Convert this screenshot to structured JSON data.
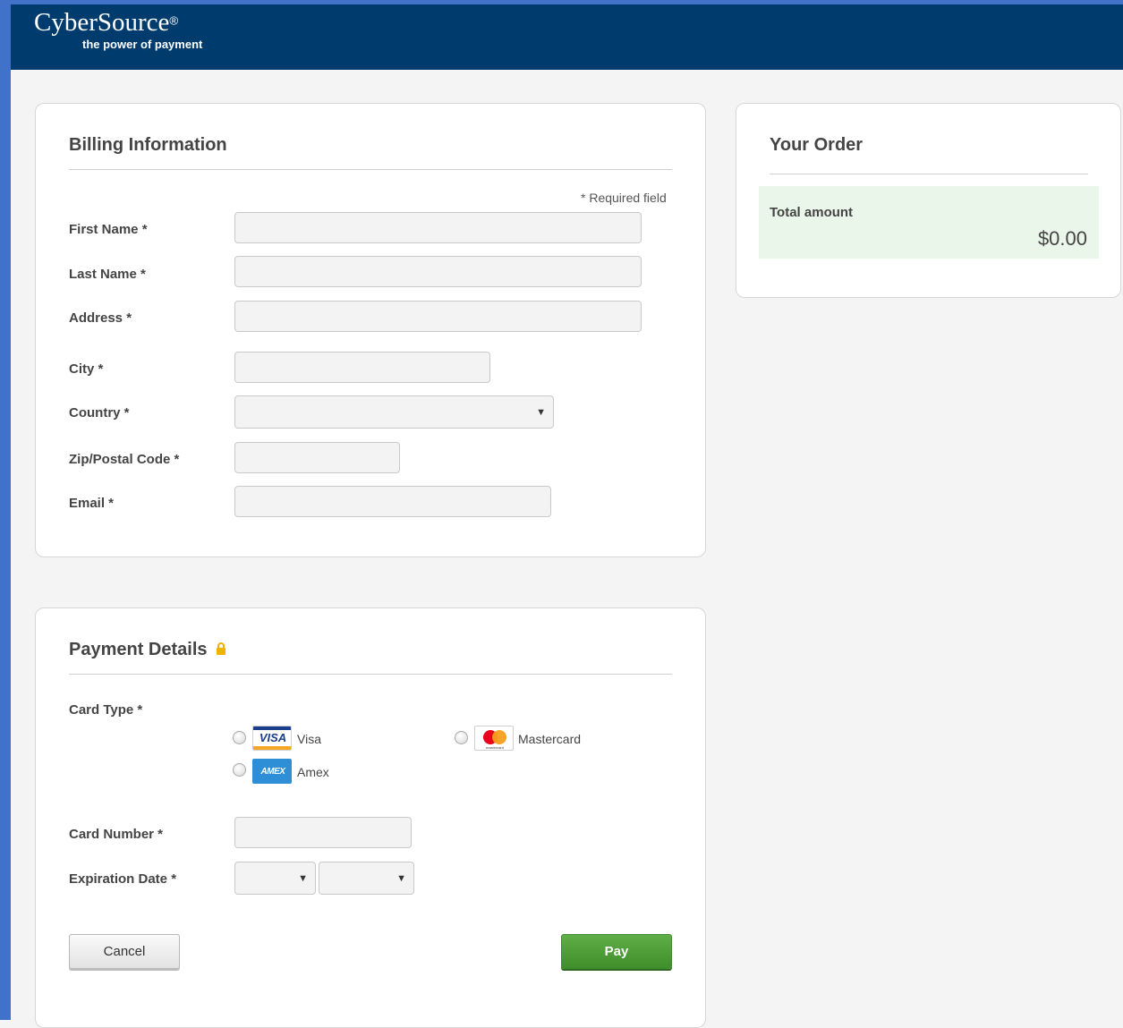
{
  "header": {
    "brand_name": "CyberSource",
    "brand_mark": "®",
    "tagline": "the power of payment"
  },
  "billing": {
    "title": "Billing Information",
    "required_note": "* Required field",
    "fields": {
      "first_name": {
        "label": "First Name *",
        "value": ""
      },
      "last_name": {
        "label": "Last Name *",
        "value": ""
      },
      "address": {
        "label": "Address *",
        "value": ""
      },
      "city": {
        "label": "City *",
        "value": ""
      },
      "country": {
        "label": "Country *",
        "value": ""
      },
      "zip": {
        "label": "Zip/Postal Code *",
        "value": ""
      },
      "email": {
        "label": "Email *",
        "value": ""
      }
    }
  },
  "payment": {
    "title": "Payment Details",
    "lock_icon": "lock-icon",
    "card_type_label": "Card Type *",
    "card_types": {
      "visa": {
        "label": "Visa",
        "logo_text": "VISA"
      },
      "mastercard": {
        "label": "Mastercard",
        "logo_text": "mastercard"
      },
      "amex": {
        "label": "Amex",
        "logo_text": "AMEX"
      }
    },
    "card_number_label": "Card Number *",
    "card_number_value": "",
    "expiration_label": "Expiration Date *",
    "exp_month_value": "",
    "exp_year_value": "",
    "cancel_label": "Cancel",
    "pay_label": "Pay"
  },
  "order": {
    "title": "Your Order",
    "total_label": "Total amount",
    "total_value": "$0.00"
  },
  "colors": {
    "header_bg": "#003b6e",
    "accent_blue": "#3f72c8",
    "pay_green": "#4a9a35",
    "total_bg": "#eaf6ea",
    "lock_yellow": "#f2b200"
  }
}
